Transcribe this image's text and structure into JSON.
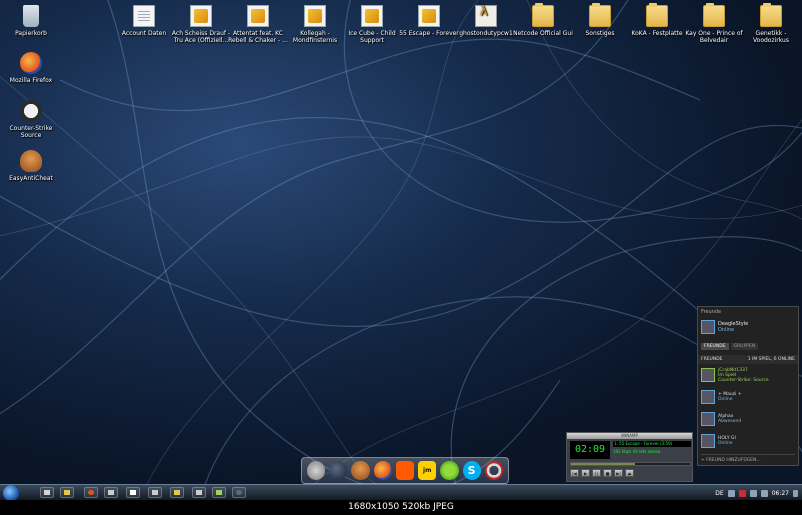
{
  "desktop": {
    "icons": [
      {
        "label": "Papierkorb",
        "icon": "recycle-bin-icon"
      },
      {
        "label": "Mozilla Firefox",
        "icon": "firefox-icon"
      },
      {
        "label": "Counter-Strike Source",
        "icon": "counter-strike-icon"
      },
      {
        "label": "EasyAntiCheat",
        "icon": "easyanticheat-icon"
      },
      {
        "label": "Account Daten",
        "icon": "text-document-icon"
      },
      {
        "label": "Ach Scheiss Drauf - Tru Ace (Offiziell...",
        "icon": "music-file-icon"
      },
      {
        "label": "Attentat feat. KC Rebell & Chaker - ...",
        "icon": "music-file-icon"
      },
      {
        "label": "Kollegah - Mondfinsternis",
        "icon": "music-file-icon"
      },
      {
        "label": "Ice Cube - Child Support",
        "icon": "music-file-icon"
      },
      {
        "label": "55 Escape - Forever",
        "icon": "music-file-icon"
      },
      {
        "label": "ghostondutypcw1",
        "icon": "half-life-icon"
      },
      {
        "label": "Netcode Official Gui",
        "icon": "folder-icon"
      },
      {
        "label": "Sonstiges",
        "icon": "folder-icon"
      },
      {
        "label": "KoKA - Festplatte",
        "icon": "folder-icon"
      },
      {
        "label": "Kay One - Prince of Belvedair",
        "icon": "folder-icon"
      },
      {
        "label": "Genetikk - Voodozirkus",
        "icon": "folder-icon"
      }
    ]
  },
  "friends": {
    "title": "Freunde",
    "me": {
      "name": "DeagleStyle",
      "status": "Online"
    },
    "tabs": {
      "friends": "FREUNDE",
      "groups": "GRUPPEN"
    },
    "group_header": {
      "label": "FREUNDE",
      "summary": "1 IM SPIEL, 6 ONLINE"
    },
    "list": [
      {
        "name": "jCrabNit1337",
        "status": "Im Spiel",
        "game": "Counter-Strike: Source"
      },
      {
        "name": "+ Mauzi +",
        "status": "Online"
      },
      {
        "name": "Alphax",
        "status": "Abwesend"
      },
      {
        "name": "HOLY GI",
        "status": "Online"
      }
    ],
    "add_friend": "FREUND HINZUFÜGEN..."
  },
  "winamp": {
    "title": "WINAMP",
    "time": "02:09",
    "track": "1. 55 Escape - Forever (3:59)",
    "info": "192 kbps  44 kHz  stereo",
    "progress": 0.54,
    "controls": [
      "|◀",
      "▶",
      "||",
      "■",
      "▶|",
      "⏏"
    ]
  },
  "taskbar": {
    "language": "DE",
    "clock": "06:27"
  },
  "caption": "1680x1050  520kb  JPEG"
}
